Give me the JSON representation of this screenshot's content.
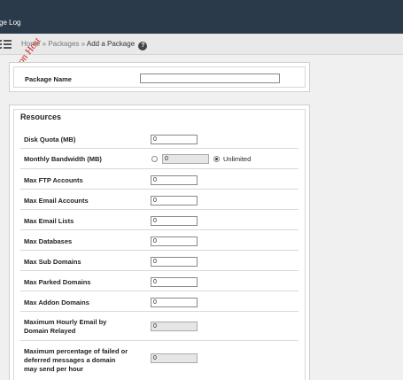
{
  "header": {
    "title": "ge Log"
  },
  "breadcrumb": {
    "home": "Home",
    "sep1": "»",
    "packages": "Packages",
    "sep2": "»",
    "current": "Add a Package",
    "help": "?"
  },
  "watermark": "Ribon Host",
  "package_name": {
    "label": "Package Name",
    "value": ""
  },
  "resources": {
    "heading": "Resources",
    "fields": [
      {
        "label": "Disk Quota (MB)",
        "value": "0"
      },
      {
        "label": "Monthly Bandwidth (MB)",
        "value": "0",
        "option_unlimited": "Unlimited"
      },
      {
        "label": "Max FTP Accounts",
        "value": "0"
      },
      {
        "label": "Max Email Accounts",
        "value": "0"
      },
      {
        "label": "Max Email Lists",
        "value": "0"
      },
      {
        "label": "Max Databases",
        "value": "0"
      },
      {
        "label": "Max Sub Domains",
        "value": "0"
      },
      {
        "label": "Max Parked Domains",
        "value": "0"
      },
      {
        "label": "Max Addon Domains",
        "value": "0"
      },
      {
        "label": "Maximum Hourly Email by Domain Relayed",
        "value": "0"
      },
      {
        "label": "Maximum percentage of failed or deferred messages a domain may send per hour",
        "value": "0"
      }
    ]
  }
}
